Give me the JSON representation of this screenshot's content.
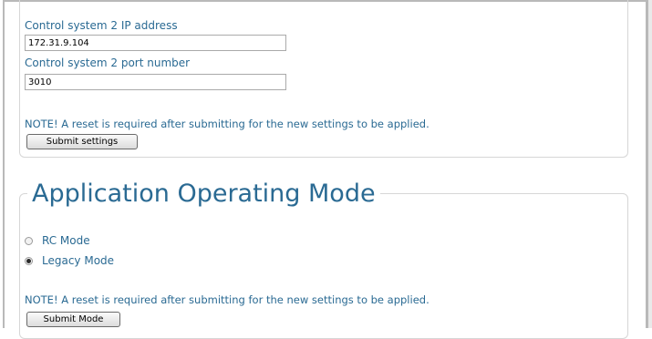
{
  "control_system": {
    "ip_label": "Control system 2 IP address",
    "ip_value": "172.31.9.104",
    "port_label": "Control system 2 port number",
    "port_value": "3010",
    "note": "NOTE! A reset is required after submitting for the new settings to be applied.",
    "submit_label": "Submit settings"
  },
  "operating_mode": {
    "title": "Application Operating Mode",
    "options": [
      {
        "label": "RC Mode",
        "checked": false
      },
      {
        "label": "Legacy Mode",
        "checked": true
      }
    ],
    "note": "NOTE! A reset is required after submitting for the new settings to be applied.",
    "submit_label": "Submit Mode"
  }
}
